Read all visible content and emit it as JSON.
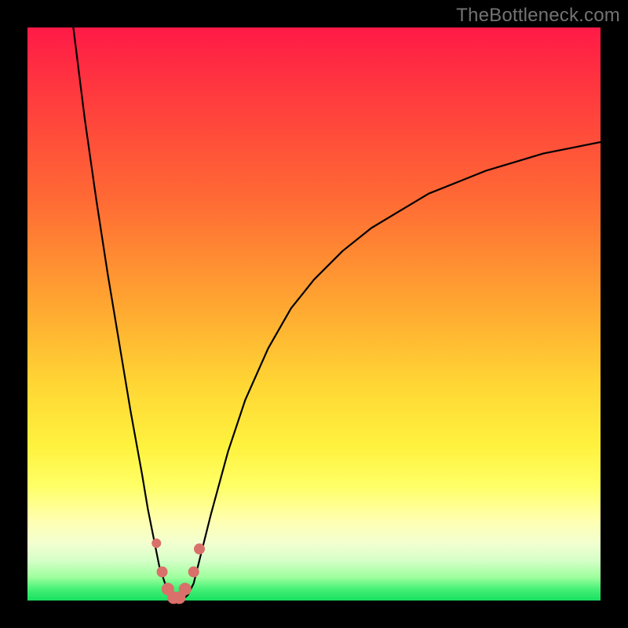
{
  "watermark": "TheBottleneck.com",
  "colors": {
    "frame": "#000000",
    "curve": "#000000",
    "marker": "#d9706a",
    "gradient_top": "#ff1a47",
    "gradient_bottom": "#18e060"
  },
  "chart_data": {
    "type": "line",
    "title": "",
    "xlabel": "",
    "ylabel": "",
    "xlim": [
      0,
      100
    ],
    "ylim": [
      0,
      100
    ],
    "series": [
      {
        "name": "bottleneck-curve",
        "x": [
          8,
          9,
          10,
          12,
          14,
          16,
          18,
          20,
          21,
          22,
          23,
          24,
          25,
          26,
          27,
          28,
          29,
          30,
          32,
          35,
          38,
          42,
          46,
          50,
          55,
          60,
          65,
          70,
          75,
          80,
          85,
          90,
          95,
          100
        ],
        "y": [
          100,
          92,
          84,
          70,
          57,
          45,
          33,
          22,
          16,
          11,
          6,
          3,
          1,
          0,
          0,
          1,
          3,
          7,
          15,
          26,
          35,
          44,
          51,
          56,
          61,
          65,
          68,
          71,
          73,
          75,
          76.5,
          78,
          79,
          80
        ]
      }
    ],
    "markers": {
      "name": "highlight-points",
      "x": [
        22.5,
        23.5,
        24.5,
        25.5,
        26.5,
        27.5,
        29.0,
        30.0
      ],
      "y": [
        10,
        5,
        2,
        0.5,
        0.5,
        2,
        5,
        9
      ],
      "r": [
        6,
        7,
        8,
        8,
        8,
        8,
        7,
        7
      ]
    }
  }
}
